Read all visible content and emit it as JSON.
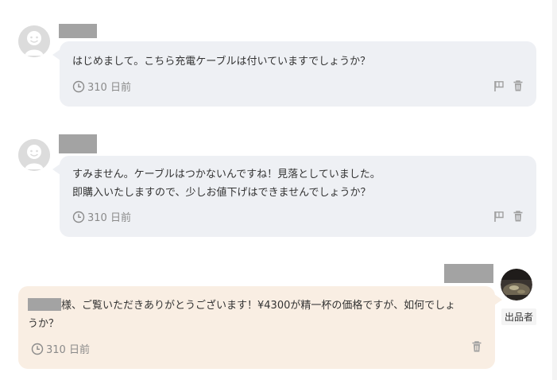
{
  "messages": [
    {
      "role": "buyer",
      "lines": [
        "はじめまして。こちら充電ケーブルは付いていますでしょうか？"
      ],
      "time": "310 日前"
    },
    {
      "role": "buyer",
      "lines": [
        "すみません。ケーブルはつかないんですね！見落としていました。",
        "即購入いたしますので、少しお値下げはできませんでしょうか？"
      ],
      "time": "310 日前"
    },
    {
      "role": "seller",
      "line1_suffix": "様、ご覧いただきありがとうございます！¥4300が精一杯の価格ですが、如何でしょ",
      "line2": "うか？",
      "time": "310 日前",
      "badge": "出品者"
    }
  ],
  "icons": {
    "time": "clock-icon",
    "report": "flag-icon",
    "delete": "trash-icon"
  },
  "colors": {
    "buyer_bubble": "#eef0f4",
    "seller_bubble": "#f9eee3",
    "redaction": "#a3a3a3",
    "meta_text": "#8a8a8a"
  }
}
